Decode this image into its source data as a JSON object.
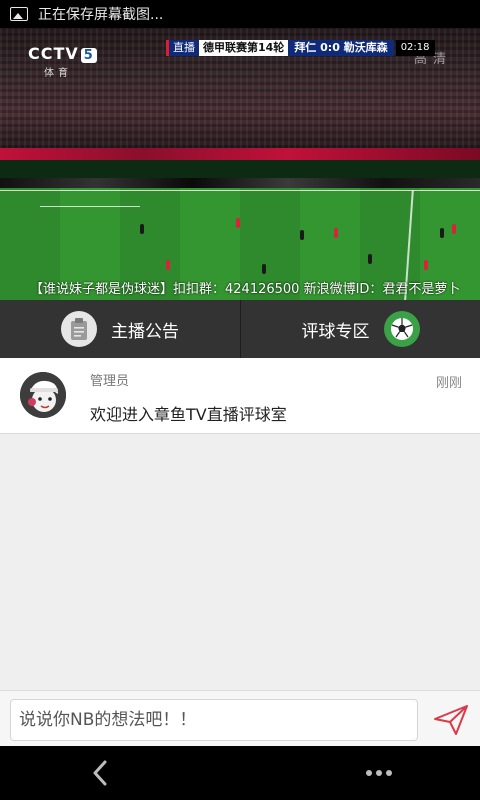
{
  "status_bar": {
    "notification": "正在保存屏幕截图...",
    "icon": "image-icon"
  },
  "video": {
    "channel": "CCTV",
    "channel_number": "5",
    "channel_sub": "体育",
    "hd_label": "高清",
    "score_bar": {
      "live": "直播",
      "league": "德甲联赛第14轮",
      "teams": "拜仁 0:0 勒沃库森",
      "clock": "02:18"
    },
    "ticker": "【谁说妹子都是伪球迷】扣扣群：424126500 新浪微博ID：君君不是萝卜"
  },
  "tabs": [
    {
      "label": "主播公告",
      "icon": "clipboard-icon"
    },
    {
      "label": "评球专区",
      "icon": "soccer-ball-icon"
    }
  ],
  "messages": [
    {
      "name": "管理员",
      "time": "刚刚",
      "text": "欢迎进入章鱼TV直播评球室",
      "avatar": "admin-avatar"
    }
  ],
  "input": {
    "placeholder": "说说你NB的想法吧！！"
  },
  "colors": {
    "tab_bg": "#333333",
    "accent_send": "#d93a4a",
    "ball_green": "#3aa146"
  }
}
